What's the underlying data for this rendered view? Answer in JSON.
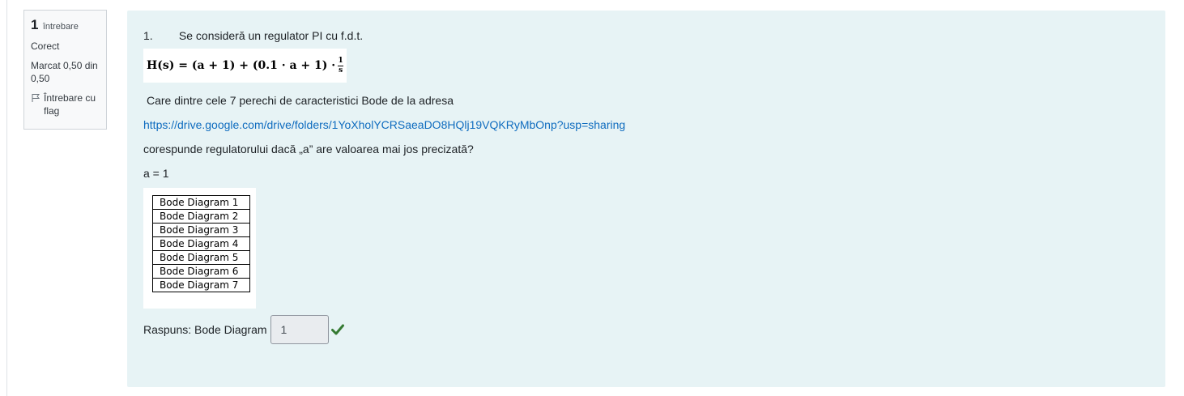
{
  "question_info": {
    "number": "1",
    "label": "întrebare",
    "state": "Corect",
    "grade": "Marcat 0,50 din 0,50",
    "flag_label": "Întrebare cu flag"
  },
  "question": {
    "item_number": "1.",
    "intro": "Se consideră un regulator PI cu f.d.t.",
    "formula": "H(s) = (a + 1) + (0.1 · a + 1) · ",
    "formula_frac_num": "1",
    "formula_frac_den": "s",
    "text_care": "Care dintre cele 7 perechi de caracteristici Bode de la adresa",
    "link": "https://drive.google.com/drive/folders/1YoXholYCRSaeaDO8HQlj19VQKRyMbOnp?usp=sharing",
    "text_corespunde": "corespunde regulatorului dacă „a” are valoarea mai jos precizată?",
    "a_value": "a = 1",
    "options": [
      "Bode Diagram 1",
      "Bode Diagram 2",
      "Bode Diagram 3",
      "Bode Diagram 4",
      "Bode Diagram 5",
      "Bode Diagram 6",
      "Bode Diagram 7"
    ],
    "answer_label": "Raspuns: Bode Diagram",
    "answer_value": "1"
  },
  "colors": {
    "content_bg": "#e7f3f5",
    "link": "#0f6cbf",
    "correct": "#357a32"
  }
}
